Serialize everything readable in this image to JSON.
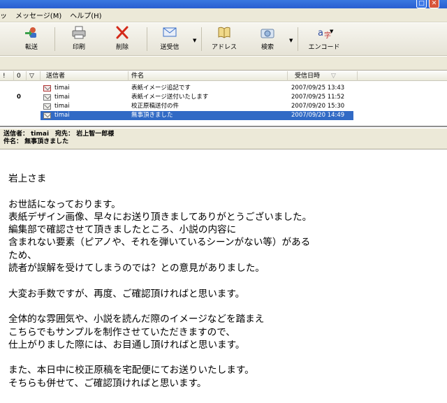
{
  "menu": {
    "items": [
      "ッ",
      "メッセージ(M)",
      "ヘルプ(H)"
    ]
  },
  "toolbar": {
    "buttons": [
      {
        "label": "信",
        "icon": "reply-icon"
      },
      {
        "label": "転送",
        "icon": "forward-icon"
      },
      {
        "label": "印刷",
        "icon": "printer-icon"
      },
      {
        "label": "削除",
        "icon": "delete-icon"
      },
      {
        "label": "送受信",
        "icon": "send-receive-icon"
      },
      {
        "label": "アドレス",
        "icon": "address-book-icon"
      },
      {
        "label": "検索",
        "icon": "search-icon"
      },
      {
        "label": "エンコード",
        "icon": "encoding-icon"
      }
    ]
  },
  "message_list": {
    "columns": [
      "!",
      "0",
      "▽",
      "送信者",
      "件名",
      "受信日時"
    ],
    "rows": [
      {
        "sender": "timai",
        "subject": "表紙イメージ追記です",
        "date": "2007/09/25 13:43",
        "attachment": "",
        "selected": false
      },
      {
        "sender": "timai",
        "subject": "表紙イメージ送付いたします",
        "date": "2007/09/25 11:52",
        "attachment": "0",
        "selected": false
      },
      {
        "sender": "timai",
        "subject": "校正原稿送付の件",
        "date": "2007/09/20 15:30",
        "attachment": "",
        "selected": false
      },
      {
        "sender": "timai",
        "subject": "無事頂きました",
        "date": "2007/09/20 14:49",
        "attachment": "",
        "selected": true
      }
    ]
  },
  "preview": {
    "from_line": "送信者： timai　宛先： 岩上智一郎様",
    "subject_line": "件名： 無事頂きました"
  },
  "body_lines": [
    "岩上さま",
    "",
    "お世話になっております。",
    "表紙デザイン画像、早々にお送り頂きましてありがとうございました。",
    "編集部で確認させて頂きましたところ、小説の内容に",
    "含まれない要素（ピアノや、それを弾いているシーンがない等）がある",
    "ため、",
    "読者が誤解を受けてしまうのでは？との意見がありました。",
    "",
    "大変お手数ですが、再度、ご確認頂ければと思います。",
    "",
    "全体的な雰囲気や、小説を読んだ際のイメージなどを踏まえ",
    "こちらでもサンプルを制作させていただきますので、",
    "仕上がりました際には、お目通し頂ければと思います。",
    "",
    "また、本日中に校正原稿を宅配便にてお送りいたします。",
    "そちらも併せて、ご確認頂ければと思います。"
  ],
  "colors": {
    "selection": "#316ac5",
    "chrome": "#ece9d8"
  }
}
